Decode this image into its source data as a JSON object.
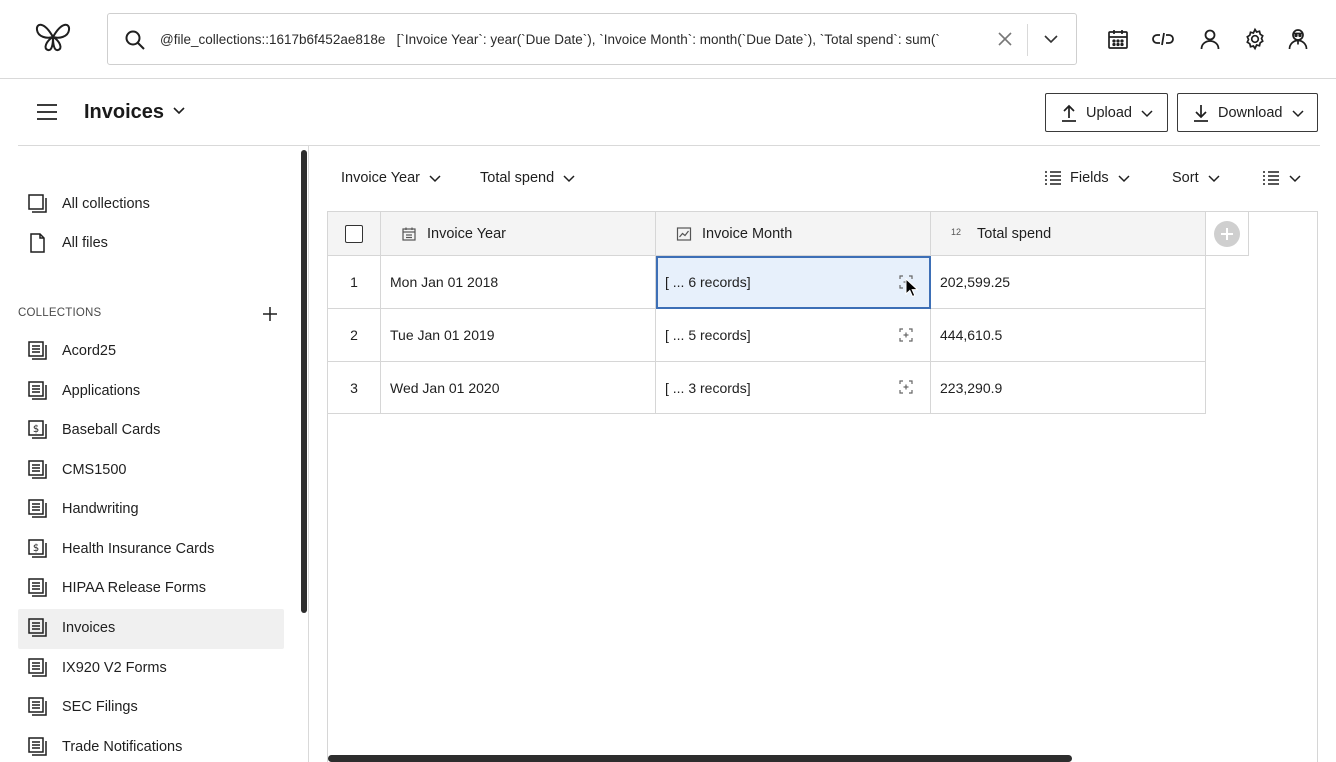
{
  "search": {
    "value": "@file_collections::1617b6f452ae818e   [`Invoice Year`: year(`Due Date`), `Invoice Month`: month(`Due Date`), `Total spend`: sum(`"
  },
  "page": {
    "title": "Invoices"
  },
  "header_buttons": {
    "upload": "Upload",
    "download": "Download"
  },
  "sidebar": {
    "top_items": [
      {
        "label": "All collections"
      },
      {
        "label": "All files"
      }
    ],
    "collections_header": "COLLECTIONS",
    "collections": [
      {
        "label": "Acord25"
      },
      {
        "label": "Applications"
      },
      {
        "label": "Baseball Cards"
      },
      {
        "label": "CMS1500"
      },
      {
        "label": "Handwriting"
      },
      {
        "label": "Health Insurance Cards"
      },
      {
        "label": "HIPAA Release Forms"
      },
      {
        "label": "Invoices",
        "active": true
      },
      {
        "label": "IX920 V2 Forms"
      },
      {
        "label": "SEC Filings"
      },
      {
        "label": "Trade Notifications"
      }
    ]
  },
  "toolbar": {
    "group_by": "Invoice Year",
    "aggregate": "Total spend",
    "fields": "Fields",
    "sort": "Sort"
  },
  "table": {
    "columns": [
      {
        "label": "Invoice Year",
        "icon": "calendar-icon"
      },
      {
        "label": "Invoice Month",
        "icon": "chart-icon"
      },
      {
        "label": "Total spend",
        "icon": "number-icon",
        "icon_text": "12"
      }
    ],
    "rows": [
      {
        "num": "1",
        "year": "Mon Jan 01 2018",
        "month": "[ ... 6 records]",
        "total": "202,599.25",
        "selected": true
      },
      {
        "num": "2",
        "year": "Tue Jan 01 2019",
        "month": "[ ... 5 records]",
        "total": "444,610.5"
      },
      {
        "num": "3",
        "year": "Wed Jan 01 2020",
        "month": "[ ... 3 records]",
        "total": "223,290.9"
      }
    ]
  },
  "colors": {
    "selection_border": "#3d6fb6",
    "selection_bg": "#e7f0fb",
    "active_nav_bg": "#f0f0f0"
  }
}
